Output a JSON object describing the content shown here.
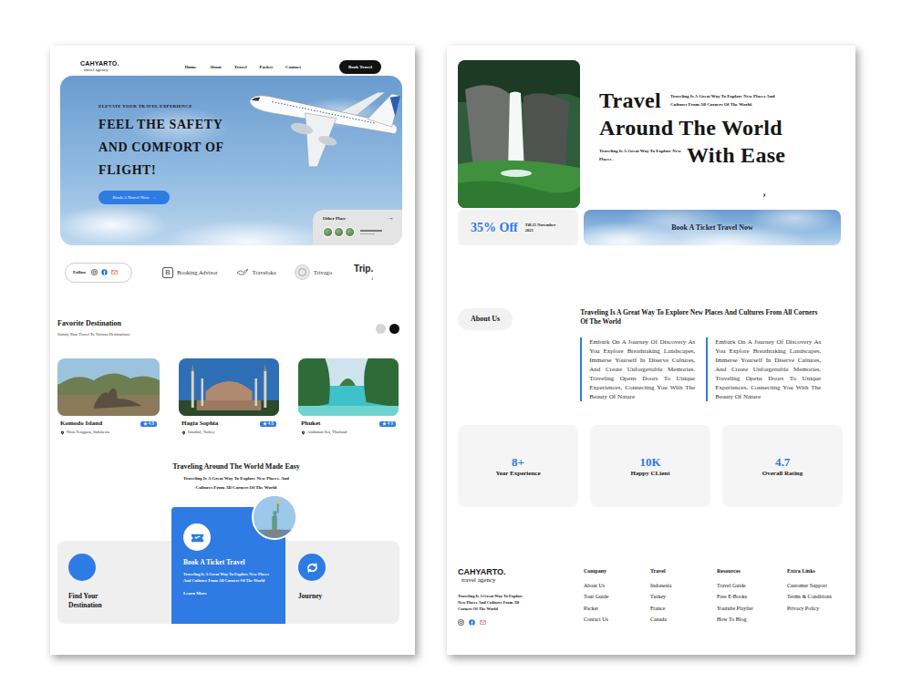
{
  "left_page": {
    "nav": {
      "logo": "CAHYARTO.",
      "tagline": "travel agency",
      "links": [
        "Home",
        "About",
        "Travel",
        "Packet",
        "Contact"
      ],
      "button": "Book Travel"
    },
    "hero": {
      "eyebrow": "ELEVATE YOUR TRAVEL EXPERIENCE",
      "title": "FEEL THE SAFETY AND COMFORT OF FLIGHT!",
      "button": "Book A Travel Now",
      "button_arrow": "›",
      "other_place": "Other Place",
      "other_arrow": "→"
    },
    "partners": {
      "follow": "Follow",
      "brands": [
        {
          "name": "Booking Advisor",
          "kind": "boxed",
          "mark": "B"
        },
        {
          "name": "Traveloka",
          "kind": "bird"
        },
        {
          "name": "Trivago",
          "kind": "circle"
        },
        {
          "name": "Trip.",
          "kind": "bold"
        }
      ],
      "prev": "‹"
    },
    "favorites": {
      "title": "Favorite Destination",
      "subtitle": "Satisfy Your Travel To Various Destinations.",
      "pager": [
        {
          "selected": false
        },
        {
          "selected": true
        }
      ],
      "cards": [
        {
          "name": "Komodo Island",
          "rating": "4.8",
          "location": "Nusa Tenggara, Indonesia"
        },
        {
          "name": "Hagia Sophia",
          "rating": "4.6",
          "location": "Istanbul, Turkey"
        },
        {
          "name": "Phuket",
          "rating": "4.9",
          "location": "Andaman Sea, Thailand"
        }
      ]
    },
    "easy": {
      "title": "Traveling Around The World Made Easy",
      "subtitle": "Traveling Is A Great Way To Explore New Places. And Cultures From All Corners Of The World"
    },
    "features": [
      {
        "title": "Find Your Destination",
        "selected": false
      },
      {
        "title": "Book A Ticket Travel",
        "text": "Traveling Is A Great Way To Explore New Places And Cultures From All Corners Of The World",
        "link": "Learn More",
        "selected": true
      },
      {
        "title": "Journey",
        "selected": false
      }
    ]
  },
  "right_page": {
    "headline": {
      "line1": "Travel",
      "note1": "Traveling Is A Great Way To Explore New Places And Cultures From All Corners Of The World.",
      "line2": "Around The World",
      "note2": "Traveling Is A Great Way To Explore New Places .",
      "line3": "With Ease",
      "arrow": "›"
    },
    "offer": {
      "discount": "35% Off",
      "until": "Till 25 November 2025",
      "cta": "Book A Ticket Travel Now"
    },
    "about": {
      "label": "About Us",
      "heading": "Traveling Is A Great Way To Explore New Places And Cultures From All Corners Of The World",
      "columns": [
        "Embark On A Journey Of Discovery As You Explore Breathtaking Landscapes, Immerse Yourself In Diserve Cultures, And Create Unforgettable Memories. Traveling Opens Doors To Unique Experiences, Connecting You With The Beauty Of Nature",
        "Embark On A Journey Of Discovery As You Explore Breathtaking Landscapes, Immerse Yourself In Diserve Cultures, And Create Unforgettable Memories. Traveling Opens Doors To Unique Experiences, Connecting You With The Beauty Of Nature"
      ]
    },
    "stats": [
      {
        "value": "8+",
        "label": "Year Experience"
      },
      {
        "value": "10K",
        "label": "Happy CLient"
      },
      {
        "value": "4.7",
        "label": "Overall Rating"
      }
    ],
    "footer": {
      "logo": "CAHYARTO.",
      "tagline": "travel agency",
      "text": "Traveling Is A Great Way To Explore New Places And Cultures From All Corners Of The World",
      "columns": [
        {
          "title": "Company",
          "links": [
            "About Us",
            "Tour Guide",
            "Packet",
            "Contact Us"
          ]
        },
        {
          "title": "Travel",
          "links": [
            "Indonesia",
            "Turkey",
            "France",
            "Canada"
          ]
        },
        {
          "title": "Resources",
          "links": [
            "Travel Guide",
            "Free E-Books",
            "Youtube Playlist",
            "How To Blog"
          ]
        },
        {
          "title": "Extra Links",
          "links": [
            "Customer Support",
            "Terms & Conditions",
            "Privacy Policy"
          ]
        }
      ]
    }
  }
}
